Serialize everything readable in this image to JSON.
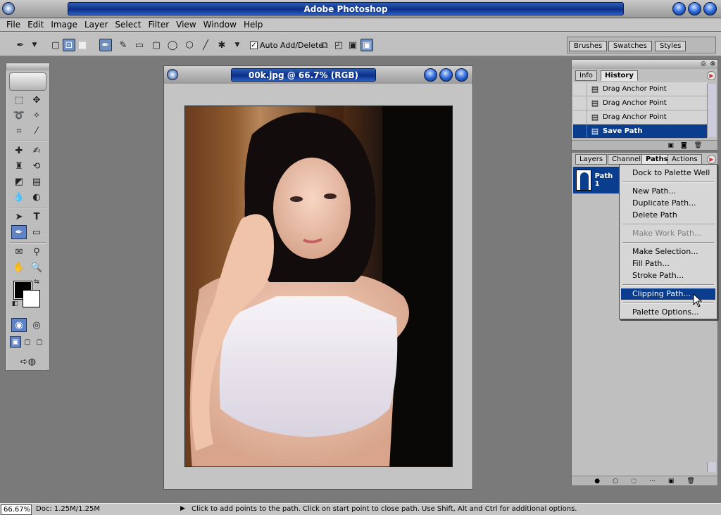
{
  "app": {
    "title": "Adobe Photoshop"
  },
  "menu": [
    "File",
    "Edit",
    "Image",
    "Layer",
    "Select",
    "Filter",
    "View",
    "Window",
    "Help"
  ],
  "options": {
    "auto_add_delete_label": "Auto Add/Delete",
    "auto_add_delete_checked": "✓"
  },
  "palette_well": {
    "tabs": [
      "Brushes",
      "Swatches",
      "Styles"
    ]
  },
  "document": {
    "title": "00k.jpg @ 66.7% (RGB)"
  },
  "history_panel": {
    "tabs": [
      "Info",
      "History"
    ],
    "items": [
      "Drag Anchor Point",
      "Drag Anchor Point",
      "Drag Anchor Point",
      "Save Path"
    ]
  },
  "paths_panel": {
    "tabs": [
      "Layers",
      "Channels",
      "Paths",
      "Actions"
    ],
    "path_name": "Path 1"
  },
  "context_menu": {
    "items": [
      "Dock to Palette Well",
      "New Path...",
      "Duplicate Path...",
      "Delete Path",
      "Make Work Path...",
      "Make Selection...",
      "Fill Path...",
      "Stroke Path...",
      "Clipping Path...",
      "Palette Options..."
    ]
  },
  "status": {
    "zoom": "66.67%",
    "doc_size": "Doc: 1.25M/1.25M",
    "message": "Click to add points to the path.  Click on start point to close path.  Use Shift, Alt and Ctrl for additional options."
  }
}
